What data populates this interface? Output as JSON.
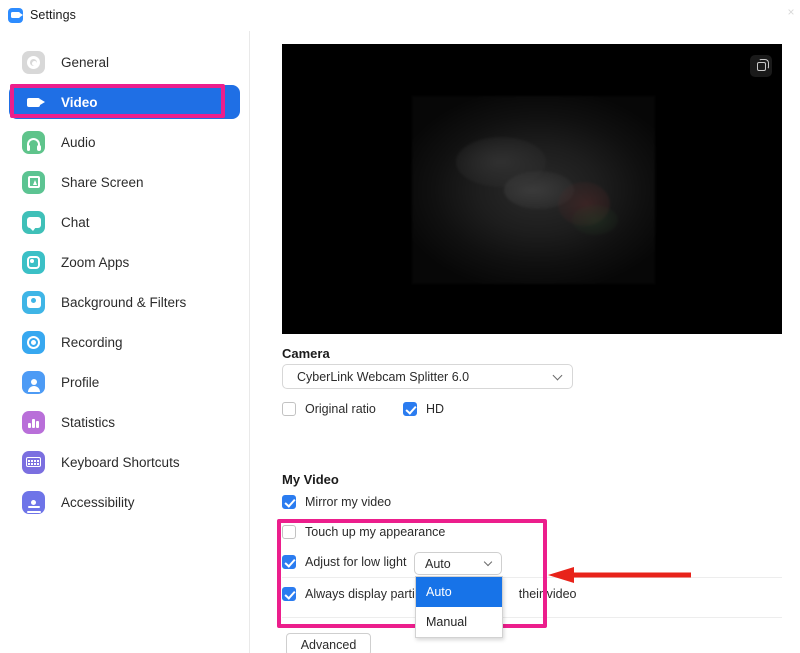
{
  "window": {
    "title": "Settings",
    "logo_icon": "zoom-camera-icon",
    "close_label": "×"
  },
  "sidebar": {
    "items": [
      {
        "label": "General",
        "icon": "gear-icon",
        "color": "#D8D8D8",
        "active": false
      },
      {
        "label": "Video",
        "icon": "video-camera-icon",
        "color": "#1F6FE5",
        "active": true
      },
      {
        "label": "Audio",
        "icon": "headphones-icon",
        "color": "#5FC48B",
        "active": false
      },
      {
        "label": "Share Screen",
        "icon": "share-screen-icon",
        "color": "#5CC492",
        "active": false
      },
      {
        "label": "Chat",
        "icon": "chat-bubble-icon",
        "color": "#3FC0B8",
        "active": false
      },
      {
        "label": "Zoom Apps",
        "icon": "zoom-apps-icon",
        "color": "#3BC0C6",
        "active": false
      },
      {
        "label": "Background & Filters",
        "icon": "background-filters-icon",
        "color": "#3FB5E6",
        "active": false
      },
      {
        "label": "Recording",
        "icon": "recording-icon",
        "color": "#37A8F0",
        "active": false
      },
      {
        "label": "Profile",
        "icon": "profile-person-icon",
        "color": "#4D9BF5",
        "active": false
      },
      {
        "label": "Statistics",
        "icon": "statistics-bars-icon",
        "color": "#B96FD9",
        "active": false
      },
      {
        "label": "Keyboard Shortcuts",
        "icon": "keyboard-icon",
        "color": "#7B6FE0",
        "active": false
      },
      {
        "label": "Accessibility",
        "icon": "accessibility-icon",
        "color": "#6E74E8",
        "active": false
      }
    ]
  },
  "video_preview": {
    "rotate_icon": "rotate-camera-icon"
  },
  "camera": {
    "section_title": "Camera",
    "selected_device": "CyberLink Webcam Splitter 6.0",
    "dropdown_icon": "chevron-down-icon",
    "original_ratio": {
      "label": "Original ratio",
      "checked": false
    },
    "hd": {
      "label": "HD",
      "checked": true
    }
  },
  "my_video": {
    "section_title": "My Video",
    "mirror": {
      "label": "Mirror my video",
      "checked": true
    },
    "touch_up": {
      "label": "Touch up my appearance",
      "checked": false
    },
    "low_light": {
      "label": "Adjust for low light",
      "checked": true,
      "selected_value": "Auto",
      "dropdown_icon": "chevron-down-icon",
      "options": [
        "Auto",
        "Manual"
      ],
      "open": true
    },
    "always_display_name": {
      "label": "Always display participant's name on their video",
      "label_left": "Always display partici",
      "label_right": "their video",
      "checked": true
    }
  },
  "footer": {
    "advanced_label": "Advanced"
  },
  "annotations": {
    "highlight_color": "#EC1E8C",
    "arrow_color": "#E8231A",
    "boxes": [
      "video-sidebar-item",
      "low-light-settings"
    ],
    "arrow": "left-pointing-arrow"
  }
}
